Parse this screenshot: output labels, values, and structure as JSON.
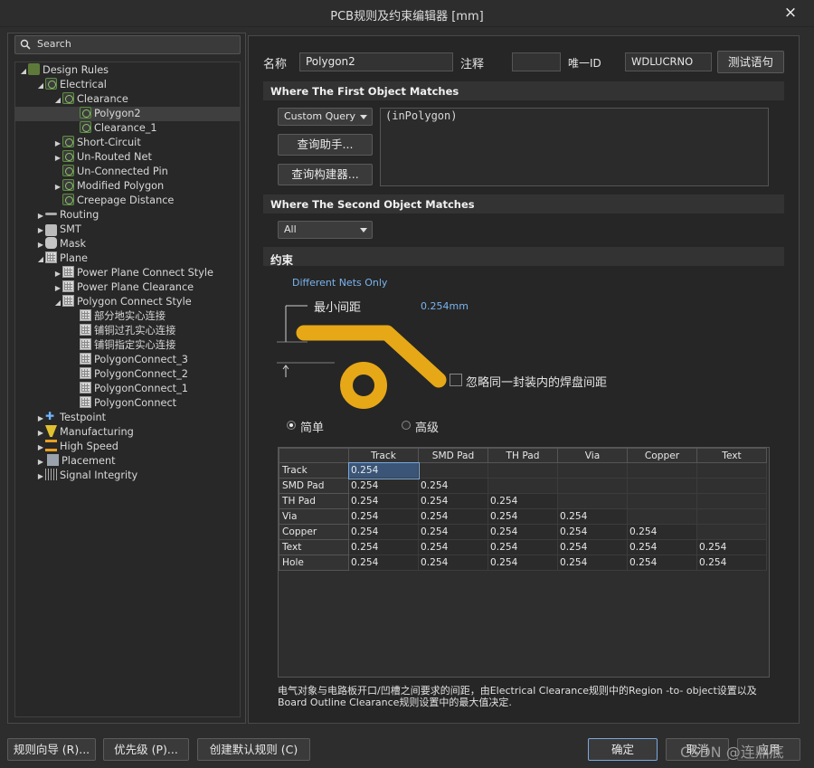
{
  "window": {
    "title": "PCB规则及约束编辑器 [mm]",
    "close": "×"
  },
  "search": {
    "label": "Search"
  },
  "tree": [
    {
      "label": "Design Rules",
      "icon": "cat",
      "depth": 0,
      "arrow": "▲"
    },
    {
      "label": "Electrical",
      "icon": "rule",
      "depth": 1,
      "arrow": "▲"
    },
    {
      "label": "Clearance",
      "icon": "rule",
      "depth": 2,
      "arrow": "▲"
    },
    {
      "label": "Polygon2",
      "icon": "rule",
      "depth": 3,
      "arrow": "",
      "selected": true
    },
    {
      "label": "Clearance_1",
      "icon": "rule",
      "depth": 3,
      "arrow": ""
    },
    {
      "label": "Short-Circuit",
      "icon": "rule",
      "depth": 2,
      "arrow": "▶"
    },
    {
      "label": "Un-Routed Net",
      "icon": "rule",
      "depth": 2,
      "arrow": "▶"
    },
    {
      "label": "Un-Connected Pin",
      "icon": "rule",
      "depth": 2,
      "arrow": ""
    },
    {
      "label": "Modified Polygon",
      "icon": "rule",
      "depth": 2,
      "arrow": "▶"
    },
    {
      "label": "Creepage Distance",
      "icon": "rule",
      "depth": 2,
      "arrow": ""
    },
    {
      "label": "Routing",
      "icon": "route",
      "depth": 1,
      "arrow": "▶"
    },
    {
      "label": "SMT",
      "icon": "smt",
      "depth": 1,
      "arrow": "▶"
    },
    {
      "label": "Mask",
      "icon": "mask",
      "depth": 1,
      "arrow": "▶"
    },
    {
      "label": "Plane",
      "icon": "grid",
      "depth": 1,
      "arrow": "▲"
    },
    {
      "label": "Power Plane Connect Style",
      "icon": "grid",
      "depth": 2,
      "arrow": "▶"
    },
    {
      "label": "Power Plane Clearance",
      "icon": "grid",
      "depth": 2,
      "arrow": "▶"
    },
    {
      "label": "Polygon Connect Style",
      "icon": "grid",
      "depth": 2,
      "arrow": "▲"
    },
    {
      "label": "部分地实心连接",
      "icon": "grid",
      "depth": 3,
      "arrow": ""
    },
    {
      "label": "铺铜过孔实心连接",
      "icon": "grid",
      "depth": 3,
      "arrow": ""
    },
    {
      "label": "铺铜指定实心连接",
      "icon": "grid",
      "depth": 3,
      "arrow": ""
    },
    {
      "label": "PolygonConnect_3",
      "icon": "grid",
      "depth": 3,
      "arrow": ""
    },
    {
      "label": "PolygonConnect_2",
      "icon": "grid",
      "depth": 3,
      "arrow": ""
    },
    {
      "label": "PolygonConnect_1",
      "icon": "grid",
      "depth": 3,
      "arrow": ""
    },
    {
      "label": "PolygonConnect",
      "icon": "grid",
      "depth": 3,
      "arrow": ""
    },
    {
      "label": "Testpoint",
      "icon": "test",
      "depth": 1,
      "arrow": "▶"
    },
    {
      "label": "Manufacturing",
      "icon": "mfg",
      "depth": 1,
      "arrow": "▶"
    },
    {
      "label": "High Speed",
      "icon": "hs",
      "depth": 1,
      "arrow": "▶"
    },
    {
      "label": "Placement",
      "icon": "place",
      "depth": 1,
      "arrow": "▶"
    },
    {
      "label": "Signal Integrity",
      "icon": "sig",
      "depth": 1,
      "arrow": "▶"
    }
  ],
  "rule": {
    "name_label": "名称",
    "name_value": "Polygon2",
    "comment_label": "注释",
    "comment_value": "",
    "uid_label": "唯一ID",
    "uid_value": "WDLUCRNO",
    "test_button": "测试语句"
  },
  "first_match": {
    "header": "Where The First Object Matches",
    "dropdown": "Custom Query",
    "query_helper": "查询助手...",
    "query_builder": "查询构建器...",
    "query": "(inPolygon)"
  },
  "second_match": {
    "header": "Where The Second Object Matches",
    "dropdown": "All"
  },
  "constraints": {
    "header": "约束",
    "net_scope": "Different Nets Only",
    "min_clearance_label": "最小间距",
    "min_clearance_value": "0.254mm",
    "ignore_pad_label": "忽略同一封装内的焊盘间距",
    "ignore_pad_checked": false,
    "mode_simple": "简单",
    "mode_advanced": "高级",
    "selected_mode": "simple"
  },
  "matrix": {
    "columns": [
      "Track",
      "SMD Pad",
      "TH Pad",
      "Via",
      "Copper",
      "Text"
    ],
    "rows": [
      {
        "name": "Track",
        "values": [
          "0.254",
          "",
          "",
          "",
          "",
          ""
        ]
      },
      {
        "name": "SMD Pad",
        "values": [
          "0.254",
          "0.254",
          "",
          "",
          "",
          ""
        ]
      },
      {
        "name": "TH Pad",
        "values": [
          "0.254",
          "0.254",
          "0.254",
          "",
          "",
          ""
        ]
      },
      {
        "name": "Via",
        "values": [
          "0.254",
          "0.254",
          "0.254",
          "0.254",
          "",
          ""
        ]
      },
      {
        "name": "Copper",
        "values": [
          "0.254",
          "0.254",
          "0.254",
          "0.254",
          "0.254",
          ""
        ]
      },
      {
        "name": "Text",
        "values": [
          "0.254",
          "0.254",
          "0.254",
          "0.254",
          "0.254",
          "0.254"
        ]
      },
      {
        "name": "Hole",
        "values": [
          "0.254",
          "0.254",
          "0.254",
          "0.254",
          "0.254",
          "0.254"
        ]
      }
    ]
  },
  "description": "电气对象与电路板开口/凹槽之间要求的间距，由Electrical Clearance规则中的Region -to- object设置以及Board Outline Clearance规则设置中的最大值决定.",
  "footer": {
    "wizard": "规则向导 (R)...",
    "priority": "优先级 (P)...",
    "default_rules": "创建默认规则 (C)",
    "ok": "确定",
    "cancel": "取消",
    "apply": "应用"
  },
  "watermark": "CSDN @连鼎底"
}
